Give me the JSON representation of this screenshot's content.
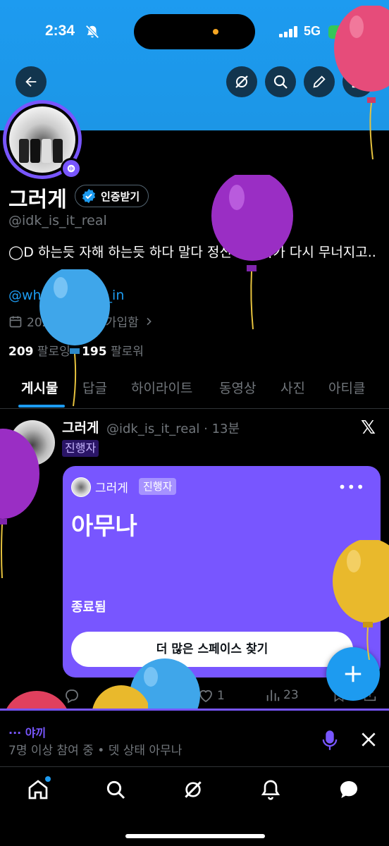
{
  "status_bar": {
    "time": "2:34",
    "network": "5G",
    "battery": "49"
  },
  "profile": {
    "name": "그러게",
    "verify_label": "인증받기",
    "handle": "@idk_is_it_real",
    "bio": "◯D 하는듯 자해 하는듯 하다 말다 정신 차리다가 다시 무너지고..",
    "bio_link": "@why_we_live_in",
    "joined": "2024년 9월에 가입함",
    "following_count": "209",
    "following_label": "팔로잉",
    "followers_count": "195",
    "followers_label": "팔로워"
  },
  "tabs": [
    {
      "label": "게시물"
    },
    {
      "label": "답글"
    },
    {
      "label": "하이라이트"
    },
    {
      "label": "동영상"
    },
    {
      "label": "사진"
    },
    {
      "label": "아티클"
    }
  ],
  "post": {
    "author": "그러게",
    "meta": "@idk_is_it_real · 13분",
    "host_tag": "진행자",
    "space": {
      "host_name": "그러게",
      "host_tag": "진행자",
      "title": "아무나",
      "status": "종료됨",
      "button_label": "더 많은 스페이스 찾기"
    },
    "likes": "1",
    "views": "23"
  },
  "dock": {
    "title": "··· 야끼",
    "subtitle": "7명 이상 참여 중 • 뎃 상태 아무나"
  },
  "icons": {
    "back": "arrow-left-icon",
    "grok": "grok-icon",
    "search": "search-icon",
    "edit": "pencil-icon",
    "share": "share-icon"
  },
  "colors": {
    "accent": "#1d9bf0",
    "spaces": "#7856ff",
    "banner": "#1d9bf0"
  }
}
